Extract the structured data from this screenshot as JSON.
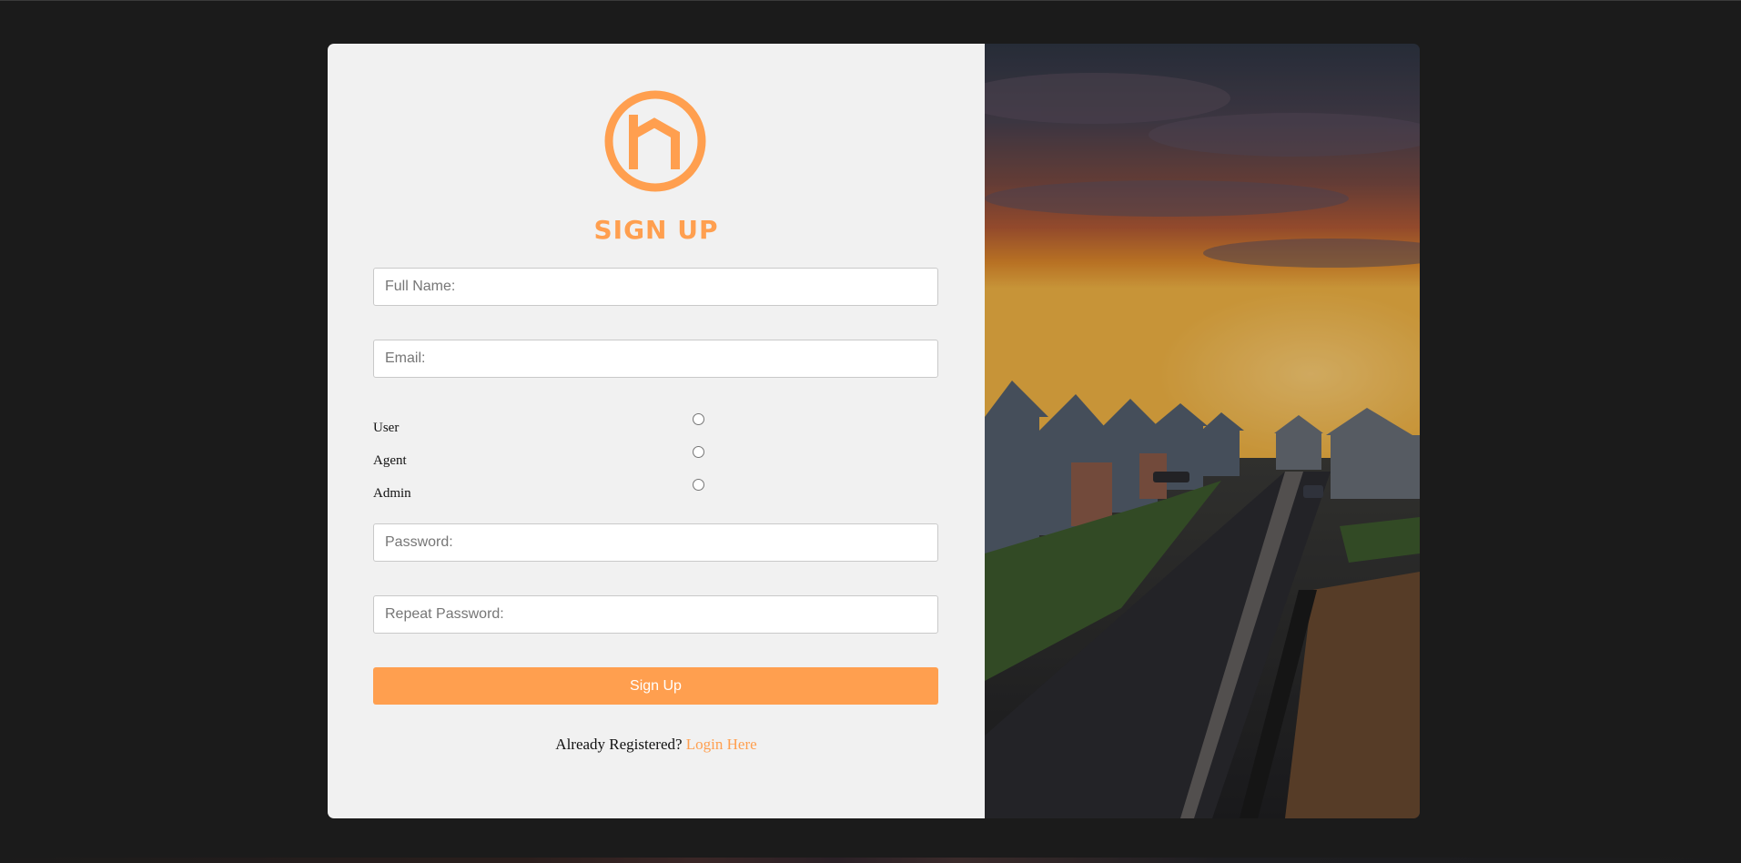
{
  "page": {
    "title": "SIGN UP"
  },
  "form": {
    "full_name_placeholder": "Full Name:",
    "email_placeholder": "Email:",
    "password_placeholder": "Password:",
    "repeat_password_placeholder": "Repeat Password:",
    "roles": [
      {
        "label": "User",
        "value": "user"
      },
      {
        "label": "Agent",
        "value": "agent"
      },
      {
        "label": "Admin",
        "value": "admin"
      }
    ],
    "submit_label": "Sign Up",
    "login_prompt": "Already Registered?",
    "login_link": "Login Here"
  },
  "colors": {
    "accent": "#ff9f4f",
    "page_background": "#1b1b1b",
    "panel_background": "#f1f1f1"
  },
  "icons": {
    "logo": "house-h-circle-logo"
  }
}
